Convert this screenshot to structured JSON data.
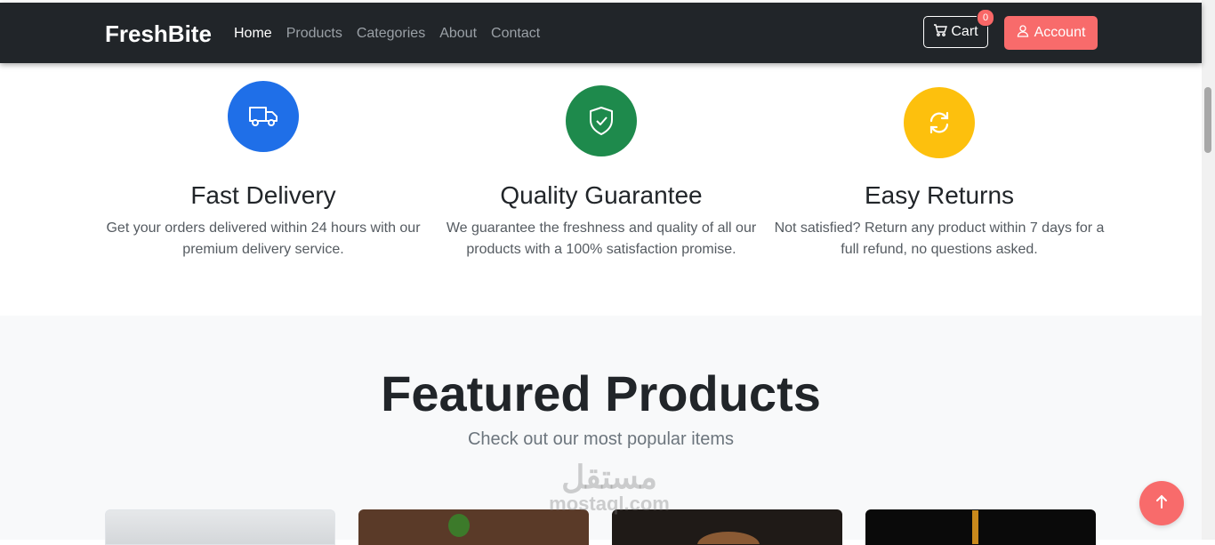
{
  "navbar": {
    "brand": "FreshBite",
    "links": [
      {
        "label": "Home",
        "active": true
      },
      {
        "label": "Products",
        "active": false
      },
      {
        "label": "Categories",
        "active": false
      },
      {
        "label": "About",
        "active": false
      },
      {
        "label": "Contact",
        "active": false
      }
    ],
    "cart_label": "Cart",
    "cart_count": "0",
    "account_label": "Account"
  },
  "features": [
    {
      "icon": "truck-icon",
      "color": "#1f6fe8",
      "title": "Fast Delivery",
      "text": "Get your orders delivered within 24 hours with our premium delivery service."
    },
    {
      "icon": "shield-check-icon",
      "color": "#1e8a4c",
      "title": "Quality Guarantee",
      "text": "We guarantee the freshness and quality of all our products with a 100% satisfaction promise."
    },
    {
      "icon": "refresh-icon",
      "color": "#fdc00d",
      "title": "Easy Returns",
      "text": "Not satisfied? Return any product within 7 days for a full refund, no questions asked."
    }
  ],
  "featured": {
    "title": "Featured Products",
    "subtitle": "Check out our most popular items"
  },
  "watermark": {
    "arabic": "مستقل",
    "latin": "mostaql.com"
  },
  "colors": {
    "accent": "#f86b6b",
    "dark": "#212529"
  }
}
